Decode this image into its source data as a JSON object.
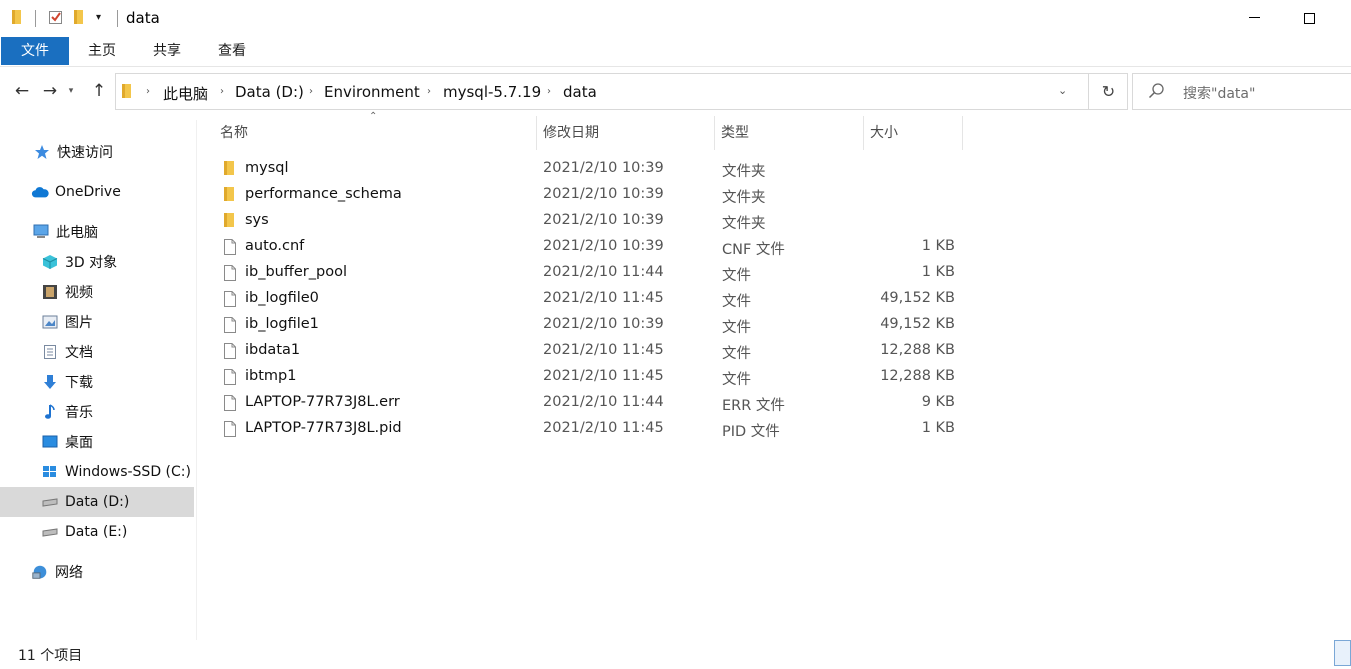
{
  "window": {
    "title": "data"
  },
  "ribbon": {
    "tabs": [
      "文件",
      "主页",
      "共享",
      "查看"
    ]
  },
  "address": {
    "segments": [
      "此电脑",
      "Data (D:)",
      "Environment",
      "mysql-5.7.19",
      "data"
    ]
  },
  "search": {
    "placeholder": "搜索\"data\""
  },
  "sidebar": {
    "items": [
      {
        "label": "快速访问",
        "icon": "star-icon"
      },
      {
        "label": "OneDrive",
        "icon": "cloud-icon"
      },
      {
        "label": "此电脑",
        "icon": "computer-icon"
      },
      {
        "label": "3D 对象",
        "icon": "cube-icon"
      },
      {
        "label": "视频",
        "icon": "film-icon"
      },
      {
        "label": "图片",
        "icon": "picture-icon"
      },
      {
        "label": "文档",
        "icon": "document-icon"
      },
      {
        "label": "下载",
        "icon": "download-icon"
      },
      {
        "label": "音乐",
        "icon": "music-icon"
      },
      {
        "label": "桌面",
        "icon": "desktop-icon"
      },
      {
        "label": "Windows-SSD (C:)",
        "icon": "windows-drive-icon"
      },
      {
        "label": "Data (D:)",
        "icon": "drive-icon",
        "selected": true
      },
      {
        "label": "Data (E:)",
        "icon": "drive-icon"
      },
      {
        "label": "网络",
        "icon": "network-icon"
      }
    ]
  },
  "columns": {
    "name": "名称",
    "date": "修改日期",
    "type": "类型",
    "size": "大小"
  },
  "files": [
    {
      "name": "mysql",
      "date": "2021/2/10 10:39",
      "type": "文件夹",
      "size": "",
      "kind": "folder"
    },
    {
      "name": "performance_schema",
      "date": "2021/2/10 10:39",
      "type": "文件夹",
      "size": "",
      "kind": "folder"
    },
    {
      "name": "sys",
      "date": "2021/2/10 10:39",
      "type": "文件夹",
      "size": "",
      "kind": "folder"
    },
    {
      "name": "auto.cnf",
      "date": "2021/2/10 10:39",
      "type": "CNF 文件",
      "size": "1 KB",
      "kind": "file"
    },
    {
      "name": "ib_buffer_pool",
      "date": "2021/2/10 11:44",
      "type": "文件",
      "size": "1 KB",
      "kind": "file"
    },
    {
      "name": "ib_logfile0",
      "date": "2021/2/10 11:45",
      "type": "文件",
      "size": "49,152 KB",
      "kind": "file"
    },
    {
      "name": "ib_logfile1",
      "date": "2021/2/10 10:39",
      "type": "文件",
      "size": "49,152 KB",
      "kind": "file"
    },
    {
      "name": "ibdata1",
      "date": "2021/2/10 11:45",
      "type": "文件",
      "size": "12,288 KB",
      "kind": "file"
    },
    {
      "name": "ibtmp1",
      "date": "2021/2/10 11:45",
      "type": "文件",
      "size": "12,288 KB",
      "kind": "file"
    },
    {
      "name": "LAPTOP-77R73J8L.err",
      "date": "2021/2/10 11:44",
      "type": "ERR 文件",
      "size": "9 KB",
      "kind": "file"
    },
    {
      "name": "LAPTOP-77R73J8L.pid",
      "date": "2021/2/10 11:45",
      "type": "PID 文件",
      "size": "1 KB",
      "kind": "file"
    }
  ],
  "status": {
    "count": "11 个项目"
  },
  "colors": {
    "accent": "#1a6fc0",
    "folder": "#f3c64b",
    "selected": "#d9d9d9"
  }
}
